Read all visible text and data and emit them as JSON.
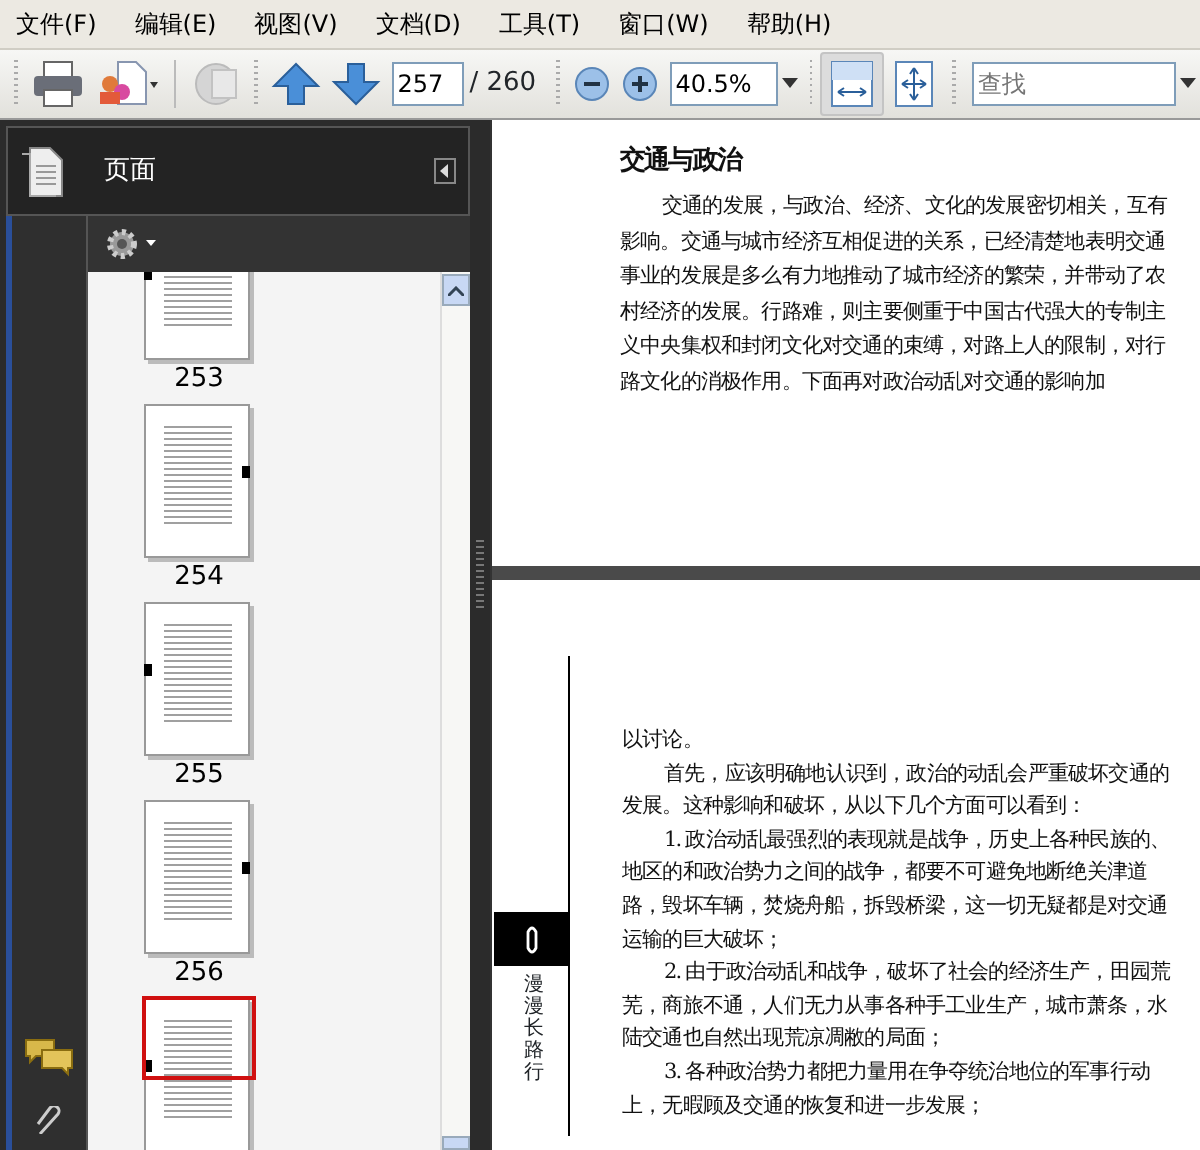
{
  "menu": [
    "文件(F)",
    "编辑(E)",
    "视图(V)",
    "文档(D)",
    "工具(T)",
    "窗口(W)",
    "帮助(H)"
  ],
  "toolbar": {
    "page_number": "257",
    "page_total": "/ 260",
    "zoom": "40.5%",
    "fit_width": {
      "pressed": true
    },
    "search": {
      "placeholder": "查找"
    }
  },
  "sidebar": {
    "title": "页面",
    "thumbnails": [
      {
        "label": "253",
        "selected": false
      },
      {
        "label": "254",
        "selected": false
      },
      {
        "label": "255",
        "selected": false
      },
      {
        "label": "256",
        "selected": false
      },
      {
        "selected": true
      }
    ]
  },
  "document": {
    "pages": [
      {
        "heading": "交通与政治",
        "paragraphs": [
          {
            "text": "交通的发展，与政治、经济、文化的发展密切相关，互有影响。交通与城市经济互相促进的关系，已经清楚地表明交通事业的发展是多么有力地推动了城市经济的繁荣，并带动了农村经济的发展。行路难，则主要侧重于中国古代强大的专制主义中央集权和封闭文化对交通的束缚，对路上人的限制，对行路文化的消极作用。下面再对政治动乱对交通的影响加",
            "indent": true
          }
        ]
      },
      {
        "side_text": "漫漫长路行",
        "paragraphs": [
          {
            "text": "以讨论。",
            "indent": false
          },
          {
            "text": "首先，应该明确地认识到，政治的动乱会严重破坏交通的发展。这种影响和破坏，从以下几个方面可以看到：",
            "indent": true
          },
          {
            "text": "1. 政治动乱最强烈的表现就是战争，历史上各种民族的、地区的和政治势力之间的战争，都要不可避免地断绝关津道路，毁坏车辆，焚烧舟船，拆毁桥梁，这一切无疑都是对交通运输的巨大破坏；",
            "indent": true
          },
          {
            "text": "2. 由于政治动乱和战争，破坏了社会的经济生产，田园荒芜，商旅不通，人们无力从事各种手工业生产，城市萧条，水陆交通也自然出现荒凉凋敝的局面；",
            "indent": true
          },
          {
            "text": "3. 各种政治势力都把力量用在争夺统治地位的军事行动上，无暇顾及交通的恢复和进一步发展；",
            "indent": true
          }
        ]
      }
    ]
  }
}
